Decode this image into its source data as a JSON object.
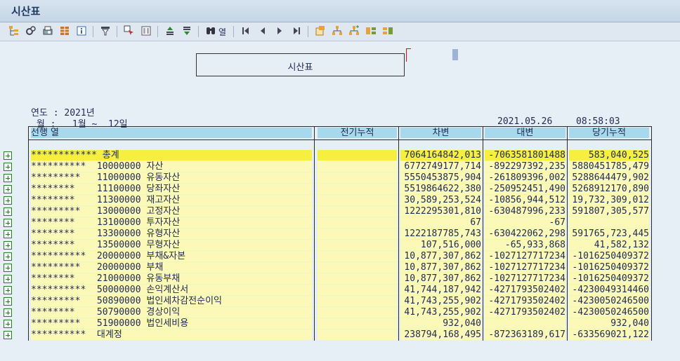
{
  "window": {
    "title": "시산표"
  },
  "toolbar": {
    "find_label": "열",
    "buttons": [
      "tree-icon",
      "settings-icon",
      "print-preview-icon",
      "grid-icon",
      "info-icon",
      "filter-icon",
      "select-icon",
      "layout-icon",
      "sort-ascending-icon",
      "sort-descending-icon",
      "find-icon",
      "first-page-icon",
      "previous-page-icon",
      "next-page-icon",
      "last-page-icon",
      "export-icon",
      "hierarchy-icon",
      "add-node-icon",
      "expand-icon",
      "collapse-icon"
    ]
  },
  "report": {
    "title": "시산표",
    "year_line": "연도 : 2021년",
    "month_line": " 월 :   1월 ~  12일",
    "date": "2021.05.26",
    "time": "08:58:03"
  },
  "columns": [
    "선행 열",
    "전기누적",
    "차변",
    "대변",
    "당기누적"
  ],
  "rows": [
    {
      "label": "************ 총계",
      "prior": "",
      "debit": "7064164842,013",
      "credit": "-7063581801488",
      "current": "583,040,525",
      "total": true
    },
    {
      "label": "**********  10000000 자산",
      "prior": "",
      "debit": "6772749177,714",
      "credit": "-892297392,235",
      "current": "5880451785,479"
    },
    {
      "label": "*********   11000000 유동자산",
      "prior": "",
      "debit": "5550453875,904",
      "credit": "-261809396,002",
      "current": "5288644479,902"
    },
    {
      "label": "********    11100000 당좌자산",
      "prior": "",
      "debit": "5519864622,380",
      "credit": "-250952451,490",
      "current": "5268912170,890"
    },
    {
      "label": "********    11300000 재고자산",
      "prior": "",
      "debit": "30,589,253,524",
      "credit": "-10856,944,512",
      "current": "19,732,309,012"
    },
    {
      "label": "*********   13000000 고정자산",
      "prior": "",
      "debit": "1222295301,810",
      "credit": "-630487996,233",
      "current": "591807,305,577"
    },
    {
      "label": "********    13100000 투자자산",
      "prior": "",
      "debit": "67",
      "credit": "-67",
      "current": ""
    },
    {
      "label": "********    13300000 유형자산",
      "prior": "",
      "debit": "1222187785,743",
      "credit": "-630422062,298",
      "current": "591765,723,445"
    },
    {
      "label": "********    13500000 무형자산",
      "prior": "",
      "debit": "107,516,000",
      "credit": "-65,933,868",
      "current": "41,582,132"
    },
    {
      "label": "**********  20000000 부채&자본",
      "prior": "",
      "debit": "10,877,307,862",
      "credit": "-1027127717234",
      "current": "-1016250409372"
    },
    {
      "label": "*********   20000000 부채",
      "prior": "",
      "debit": "10,877,307,862",
      "credit": "-1027127717234",
      "current": "-1016250409372"
    },
    {
      "label": "********    21000000 유동부채",
      "prior": "",
      "debit": "10,877,307,862",
      "credit": "-1027127717234",
      "current": "-1016250409372"
    },
    {
      "label": "**********  50000000 손익계산서",
      "prior": "",
      "debit": "41,744,187,942",
      "credit": "-4271793502402",
      "current": "-4230049314460"
    },
    {
      "label": "*********   50890000 법인세차감전순이익",
      "prior": "",
      "debit": "41,743,255,902",
      "credit": "-4271793502402",
      "current": "-4230050246500"
    },
    {
      "label": "********    50790000 경상이익",
      "prior": "",
      "debit": "41,743,255,902",
      "credit": "-4271793502402",
      "current": "-4230050246500"
    },
    {
      "label": "*********   51900000 법인세비용",
      "prior": "",
      "debit": "932,040",
      "credit": "",
      "current": "932,040"
    },
    {
      "label": "**********  대계정",
      "prior": "",
      "debit": "238794,168,495",
      "credit": "-872363189,617",
      "current": "-633569021,122"
    }
  ]
}
